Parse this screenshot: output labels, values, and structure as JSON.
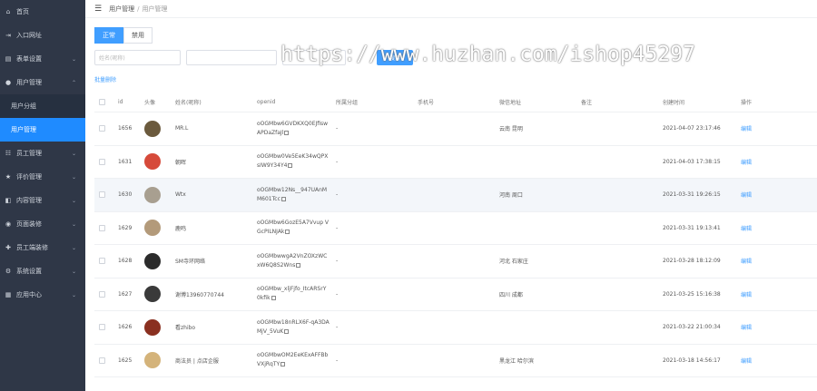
{
  "sidebar": {
    "items": [
      {
        "icon": "home-icon",
        "label": "首页",
        "chevron": false
      },
      {
        "icon": "login-icon",
        "label": "入口网址",
        "chevron": false
      },
      {
        "icon": "form-icon",
        "label": "表单设置",
        "chevron": true
      },
      {
        "icon": "user-icon",
        "label": "用户管理",
        "chevron": true,
        "expanded": true,
        "children": [
          {
            "label": "用户分组",
            "active": false
          },
          {
            "label": "用户管理",
            "active": true
          }
        ]
      },
      {
        "icon": "staff-icon",
        "label": "员工管理",
        "chevron": true
      },
      {
        "icon": "star-icon",
        "label": "评价管理",
        "chevron": true
      },
      {
        "icon": "content-icon",
        "label": "内容管理",
        "chevron": true
      },
      {
        "icon": "page-icon",
        "label": "页面装修",
        "chevron": true
      },
      {
        "icon": "staff-page-icon",
        "label": "员工端装修",
        "chevron": true
      },
      {
        "icon": "settings-icon",
        "label": "系统设置",
        "chevron": true
      },
      {
        "icon": "app-icon",
        "label": "应用中心",
        "chevron": true
      }
    ]
  },
  "breadcrumb": {
    "parent": "用户管理",
    "sep": "/",
    "current": "用户管理"
  },
  "tabs": [
    {
      "label": "正常",
      "active": true
    },
    {
      "label": "禁用",
      "active": false
    }
  ],
  "filters": {
    "name_placeholder": "姓名(昵称)",
    "search_label": "搜索"
  },
  "add_tag_label": "批量删除",
  "watermark": "https://www.huzhan.com/ishop45297",
  "table": {
    "headers": [
      "id",
      "头像",
      "姓名(昵称)",
      "openid",
      "所属分组",
      "手机号",
      "微信地址",
      "备注",
      "创建时间",
      "操作"
    ],
    "rows": [
      {
        "id": "1656",
        "nick": "MR.L",
        "openid": "oOGMbw6GVDKXQ0EJfiswAPDaZfaJl",
        "group": "-",
        "phone": "",
        "addr": "云南 昆明",
        "remark": "",
        "time": "2021-04-07 23:17:46",
        "op": "编辑",
        "avatar": "#6b5a3d",
        "hl": false
      },
      {
        "id": "1631",
        "nick": "朝晖",
        "openid": "oOGMbw0Ve5EeK34wQPXsIW9Y34Y4",
        "group": "-",
        "phone": "",
        "addr": "",
        "remark": "",
        "time": "2021-04-03 17:38:15",
        "op": "编辑",
        "avatar": "#d64a3a",
        "hl": false
      },
      {
        "id": "1630",
        "nick": "Wtx",
        "openid": "oOGMbw12Ns__947UAnMM601Tcc",
        "group": "-",
        "phone": "",
        "addr": "河南 周口",
        "remark": "",
        "time": "2021-03-31 19:26:15",
        "op": "编辑",
        "avatar": "#a89f90",
        "hl": true
      },
      {
        "id": "1629",
        "nick": "鹿鸣",
        "openid": "oOGMbw6GozE5A7Vvup VGcPILNJAk",
        "group": "-",
        "phone": "",
        "addr": "",
        "remark": "",
        "time": "2021-03-31 19:13:41",
        "op": "编辑",
        "avatar": "#b39a7a",
        "hl": false
      },
      {
        "id": "1628",
        "nick": "SM寺环网络",
        "openid": "oOGMbwwgA2VnZOXzWCxW6Q8S2Wns",
        "group": "-",
        "phone": "",
        "addr": "河北 石家庄",
        "remark": "",
        "time": "2021-03-28 18:12:09",
        "op": "编辑",
        "avatar": "#2b2b2b",
        "hl": false
      },
      {
        "id": "1627",
        "nick": "谢博13960770744",
        "openid": "oOGMbw_xljFjfo_ItcARSrY0kfik",
        "group": "-",
        "phone": "",
        "addr": "四川 成都",
        "remark": "",
        "time": "2021-03-25 15:16:38",
        "op": "编辑",
        "avatar": "#3a3a3a",
        "hl": false
      },
      {
        "id": "1626",
        "nick": "看zhibo",
        "openid": "oOGMbw18nRLX6F-qA3DAMjV_5VuK",
        "group": "-",
        "phone": "",
        "addr": "",
        "remark": "",
        "time": "2021-03-22 21:00:34",
        "op": "编辑",
        "avatar": "#8a3020",
        "hl": false
      },
      {
        "id": "1625",
        "nick": "商法员 | 点店企服",
        "openid": "oOGMbwOM2EeKExAFFBbVXjRqTY",
        "group": "-",
        "phone": "",
        "addr": "黑龙江 哈尔滨",
        "remark": "",
        "time": "2021-03-18 14:56:17",
        "op": "编辑",
        "avatar": "#d4b37a",
        "hl": false
      }
    ]
  }
}
